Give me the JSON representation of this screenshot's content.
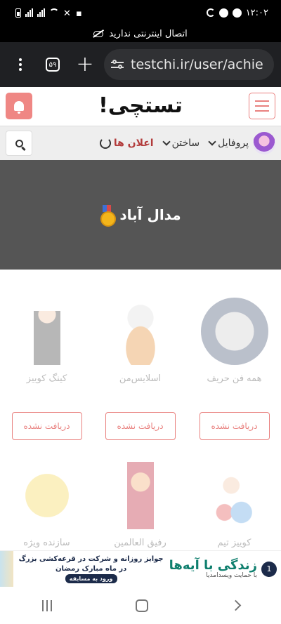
{
  "status_bar": {
    "time": "۱۲:۰۲"
  },
  "offline_notice": "اتصال اینترنتی ندارید",
  "browser": {
    "tab_count": "۵۹",
    "url": "testchi.ir/user/achie"
  },
  "header": {
    "logo": "تستچی!"
  },
  "nav": {
    "profile": "پروفایل",
    "create": "ساختن",
    "notifications": "اعلان ها"
  },
  "banner": {
    "title": "مدال آباد"
  },
  "achievements": [
    {
      "title": "همه فن حریف",
      "button": "دریافت نشده",
      "icon": "astronaut-badge-icon"
    },
    {
      "title": "اسلایس‌من",
      "button": "دریافت نشده",
      "icon": "astronaut-on-planet-icon"
    },
    {
      "title": "کینگ کوییز",
      "button": "دریافت نشده",
      "icon": "king-character-icon"
    },
    {
      "title": "کوییز تیم",
      "icon": "puzzle-kid-icon"
    },
    {
      "title": "رفیق العالمین",
      "icon": "fox-king-icon"
    },
    {
      "title": "سازنده ویژه",
      "icon": "pencil-character-icon"
    }
  ],
  "ad": {
    "badge": "1",
    "brand": "زندگی با آیه‌ها",
    "brand_sub": "با حمایت ویسدامدیا",
    "line1": "جوایز روزانه و شرکت در قرعه‌کشی بزرگ",
    "line2": "در ماه مبارک رمضان",
    "cta": "ورود به مسابقه"
  },
  "colors": {
    "accent": "#e9817f",
    "banner_bg": "#555555",
    "notification_red": "#b23b3b"
  }
}
